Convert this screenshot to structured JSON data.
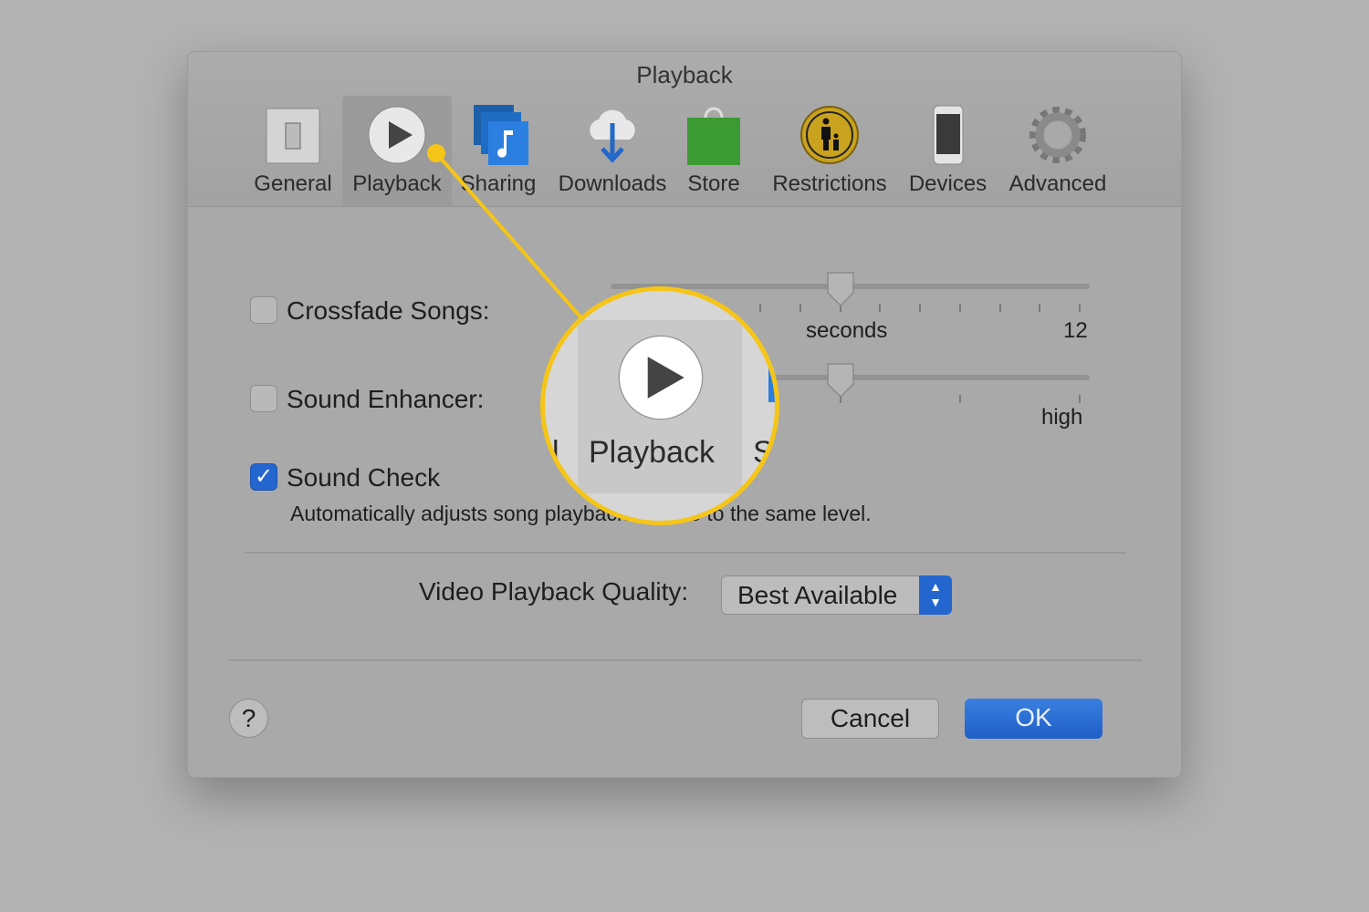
{
  "window": {
    "title": "Playback"
  },
  "tabs": [
    {
      "label": "General",
      "icon": "light-switch-icon"
    },
    {
      "label": "Playback",
      "icon": "play-icon",
      "selected": true
    },
    {
      "label": "Sharing",
      "icon": "music-note-stack-icon"
    },
    {
      "label": "Downloads",
      "icon": "cloud-download-icon"
    },
    {
      "label": "Store",
      "icon": "shopping-bag-icon"
    },
    {
      "label": "Restrictions",
      "icon": "parental-icon"
    },
    {
      "label": "Devices",
      "icon": "iphone-icon"
    },
    {
      "label": "Advanced",
      "icon": "gear-icon"
    }
  ],
  "crossfade": {
    "label": "Crossfade Songs:",
    "checked": false,
    "unit_label": "seconds",
    "max_label": "12",
    "value": 6,
    "max": 12
  },
  "enhancer": {
    "label": "Sound Enhancer:",
    "checked": false,
    "max_label": "high",
    "level": 0.5
  },
  "soundcheck": {
    "label": "Sound Check",
    "checked": true,
    "description": "Automatically adjusts song playback volume to the same level."
  },
  "video_quality": {
    "label": "Video Playback Quality:",
    "value": "Best Available"
  },
  "buttons": {
    "help": "?",
    "cancel": "Cancel",
    "ok": "OK"
  },
  "magnifier": {
    "label": "Playback",
    "left_fragment": "l",
    "right_fragment": "S"
  },
  "colors": {
    "accent": "#2466cf",
    "callout": "#f5c518"
  }
}
